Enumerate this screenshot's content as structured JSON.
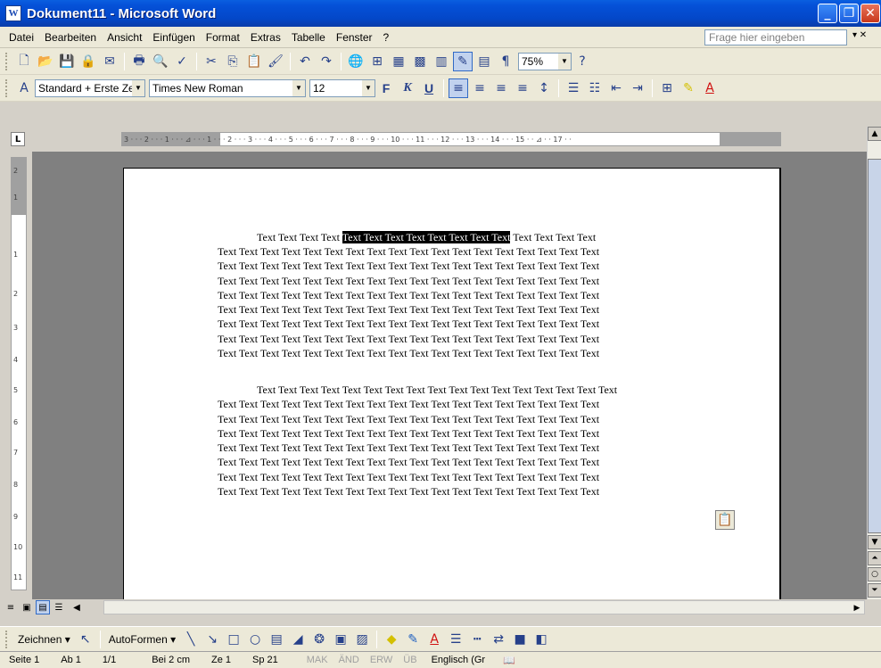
{
  "window": {
    "title": "Dokument11 - Microsoft Word"
  },
  "menu": {
    "items": [
      "Datei",
      "Bearbeiten",
      "Ansicht",
      "Einfügen",
      "Format",
      "Extras",
      "Tabelle",
      "Fenster",
      "?"
    ],
    "help_placeholder": "Frage hier eingeben"
  },
  "standard_toolbar": {
    "zoom": "75%"
  },
  "format_toolbar": {
    "style": "Standard + Erste Ze",
    "font": "Times New Roman",
    "size": "12",
    "bold": "F",
    "italic": "K",
    "underline": "U"
  },
  "ruler": {
    "h_labels": "3 · · · 2 · · · 1 · · · ⊿ · · · 1 · · · 2 · · · 3 · · · 4 · · · 5 · · · 6 · · · 7 · · · 8 · · · 9 · · · 10 · · · 11 · · · 12 · · · 13 · · · 14 · · · 15 · · ⊿ · · 17 · ·",
    "v_labels": [
      "2",
      "1",
      "1",
      "2",
      "3",
      "4",
      "5",
      "6",
      "7",
      "8",
      "9",
      "10",
      "11"
    ]
  },
  "document": {
    "p1_first_before": "Text Text Text Text ",
    "p1_selected": "Text Text Text Text Text Text Text Text",
    "p1_first_after": " Text Text Text Text",
    "p1_lines": [
      "Text Text Text Text Text Text Text Text Text Text Text Text Text Text Text Text Text Text",
      "Text Text Text Text Text Text Text Text Text Text Text Text Text Text Text Text Text Text",
      "Text Text Text Text Text Text Text Text Text Text Text Text Text Text Text Text Text Text",
      "Text Text Text Text Text Text Text Text Text Text Text Text Text Text Text Text Text Text",
      "Text Text Text Text Text Text Text Text Text Text Text Text Text Text Text Text Text Text",
      "Text Text Text Text Text Text Text Text Text Text Text Text Text Text Text Text Text Text",
      "Text Text Text Text Text Text Text Text Text Text Text Text Text Text Text Text Text Text",
      "Text Text Text Text Text Text Text Text Text Text Text Text Text Text Text Text Text Text"
    ],
    "p2_first": "Text Text Text Text Text Text Text Text Text Text Text Text Text Text Text Text Text",
    "p2_lines": [
      "Text Text Text Text Text Text Text Text Text Text Text Text Text Text Text Text Text Text",
      "Text Text Text Text Text Text Text Text Text Text Text Text Text Text Text Text Text Text",
      "Text Text Text Text Text Text Text Text Text Text Text Text Text Text Text Text Text Text",
      "Text Text Text Text Text Text Text Text Text Text Text Text Text Text Text Text Text Text",
      "Text Text Text Text Text Text Text Text Text Text Text Text Text Text Text Text Text Text",
      "Text Text Text Text Text Text Text Text Text Text Text Text Text Text Text Text Text Text",
      "Text Text Text Text Text Text Text Text Text Text Text Text Text Text Text Text Text Text",
      "Text Text Text Text Text Text Text Text Text Text Text Text Text Text Text Text Text Text"
    ]
  },
  "drawing_toolbar": {
    "draw_label": "Zeichnen ▾",
    "autoshapes_label": "AutoFormen ▾"
  },
  "status": {
    "page": "Seite 1",
    "section": "Ab 1",
    "pages": "1/1",
    "at": "Bei 2 cm",
    "line": "Ze 1",
    "col": "Sp 21",
    "mak": "MAK",
    "aend": "ÄND",
    "erw": "ERW",
    "ueb": "ÜB",
    "lang": "Englisch (Gr"
  }
}
